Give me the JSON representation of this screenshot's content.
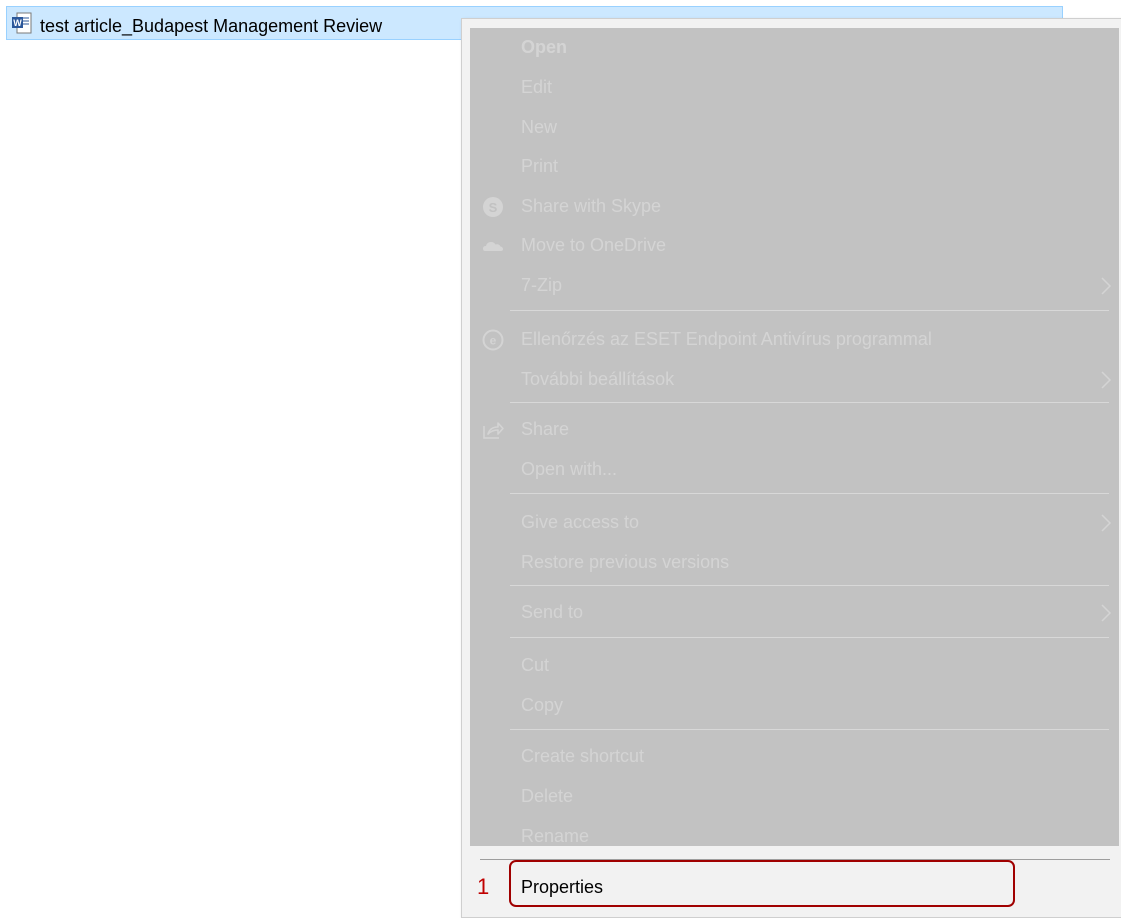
{
  "file": {
    "name": "test article_Budapest Management Review",
    "icon": "word-document-icon"
  },
  "context_menu": {
    "items": [
      {
        "id": "open",
        "label": "Open",
        "bold": true
      },
      {
        "id": "edit",
        "label": "Edit"
      },
      {
        "id": "new",
        "label": "New"
      },
      {
        "id": "print",
        "label": "Print"
      },
      {
        "id": "share-skype",
        "label": "Share with Skype",
        "icon": "skype-icon"
      },
      {
        "id": "move-onedrive",
        "label": "Move to OneDrive",
        "icon": "onedrive-cloud-icon"
      },
      {
        "id": "7zip",
        "label": "7-Zip",
        "submenu": true
      },
      {
        "id": "eset-scan",
        "label": "Ellenőrzés az ESET Endpoint Antivírus programmal",
        "icon": "eset-icon"
      },
      {
        "id": "more-settings",
        "label": "További beállítások",
        "submenu": true
      },
      {
        "id": "share",
        "label": "Share",
        "icon": "share-icon"
      },
      {
        "id": "open-with",
        "label": "Open with..."
      },
      {
        "id": "give-access",
        "label": "Give access to",
        "submenu": true
      },
      {
        "id": "restore-versions",
        "label": "Restore previous versions"
      },
      {
        "id": "send-to",
        "label": "Send to",
        "submenu": true
      },
      {
        "id": "cut",
        "label": "Cut"
      },
      {
        "id": "copy",
        "label": "Copy"
      },
      {
        "id": "create-shortcut",
        "label": "Create shortcut"
      },
      {
        "id": "delete",
        "label": "Delete"
      },
      {
        "id": "rename",
        "label": "Rename"
      }
    ],
    "properties": {
      "label": "Properties",
      "step_number": "1"
    }
  },
  "colors": {
    "selection": "#cce8ff",
    "overlay": "#c2c2c2",
    "highlight_box": "#a00000",
    "disabled_text": "#d4d4d4"
  }
}
